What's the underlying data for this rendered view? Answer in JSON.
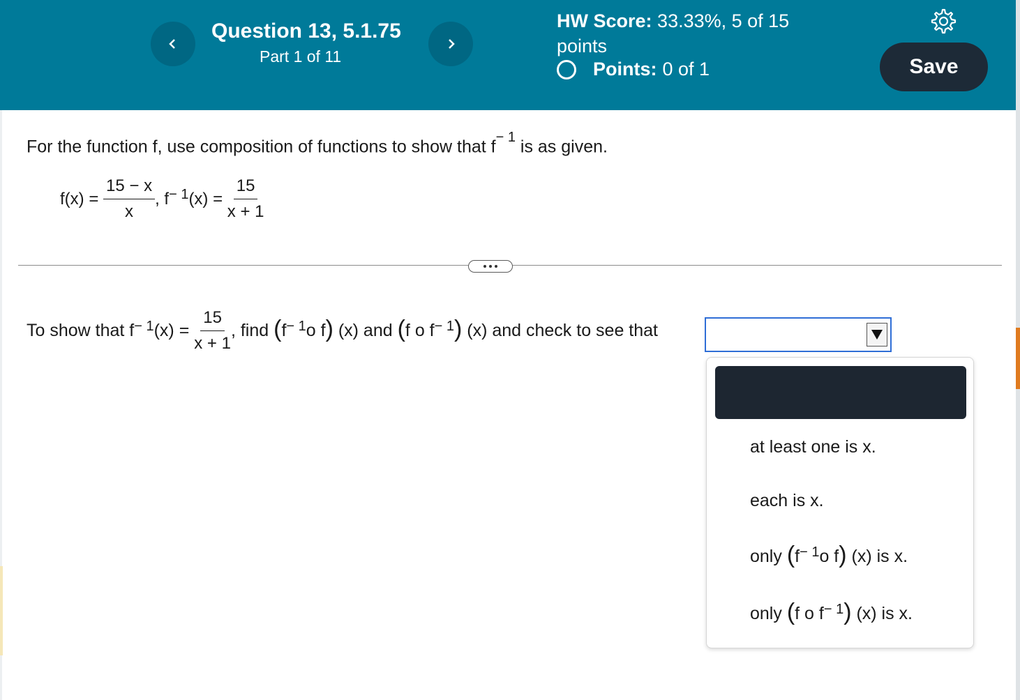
{
  "header": {
    "question_title": "Question 13, 5.1.75",
    "question_part": "Part 1 of 11",
    "hw_score_label": "HW Score:",
    "hw_score_value": "33.33%, 5 of 15 points",
    "points_label": "Points:",
    "points_value": "0 of 1",
    "save_label": "Save",
    "icons": {
      "prev": "chevron-left-icon",
      "next": "chevron-right-icon",
      "settings": "gear-icon"
    }
  },
  "question": {
    "prompt_before": "For the function f, use composition of functions to show that f",
    "prompt_sup": "− 1",
    "prompt_after": " is as given.",
    "f_lhs": "f(x) = ",
    "f_num": "15 − x",
    "f_den": "x",
    "sep": ", f",
    "finv_sup": "− 1",
    "finv_lhs": "(x) = ",
    "finv_num": "15",
    "finv_den": "x + 1"
  },
  "instruction": {
    "t1": "To show that f",
    "sup1": "− 1",
    "t2": "(x) = ",
    "frac_num": "15",
    "frac_den": "x + 1",
    "t3": ", find ",
    "c1_a": "f",
    "c1_sup": "− 1",
    "c1_b": "o f",
    "t4": " (x) and ",
    "c2_a": "f o f",
    "c2_sup": "− 1",
    "t5": " (x) and check to see that"
  },
  "dropdown": {
    "selected_value": "",
    "options": [
      "at least one is x.",
      "each is x.",
      {
        "pre": "only ",
        "a": "f",
        "sup": "− 1",
        "b": "o f",
        "post": " (x) is x."
      },
      {
        "pre": "only ",
        "a": "f o f",
        "sup": "− 1",
        "post": " (x) is x."
      }
    ]
  },
  "colors": {
    "header_bg": "#007a99",
    "nav_btn": "#006783",
    "save_btn": "#1d2a37",
    "dropdown_border": "#2f6ed6",
    "menu_selected": "#1d2631"
  }
}
